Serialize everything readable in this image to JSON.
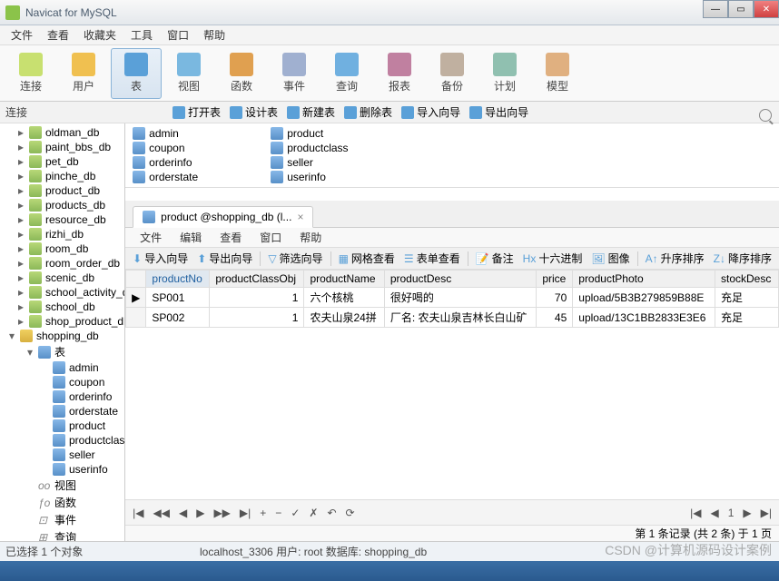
{
  "title": "Navicat for MySQL",
  "menu": [
    "文件",
    "查看",
    "收藏夹",
    "工具",
    "窗口",
    "帮助"
  ],
  "toolbar": [
    {
      "label": "连接",
      "color": "#c8e070"
    },
    {
      "label": "用户",
      "color": "#f0c050"
    },
    {
      "label": "表",
      "color": "#5aa0d8",
      "selected": true
    },
    {
      "label": "视图",
      "color": "#7ab8e0"
    },
    {
      "label": "函数",
      "color": "#e0a050"
    },
    {
      "label": "事件",
      "color": "#a0b0d0"
    },
    {
      "label": "查询",
      "color": "#70b0e0"
    },
    {
      "label": "报表",
      "color": "#c080a0"
    },
    {
      "label": "备份",
      "color": "#c0b0a0"
    },
    {
      "label": "计划",
      "color": "#90c0b0"
    },
    {
      "label": "模型",
      "color": "#e0b080"
    }
  ],
  "ribbon_left": "连接",
  "ribbon": [
    "打开表",
    "设计表",
    "新建表",
    "删除表",
    "导入向导",
    "导出向导"
  ],
  "tree": {
    "databases": [
      "oldman_db",
      "paint_bbs_db",
      "pet_db",
      "pinche_db",
      "product_db",
      "products_db",
      "resource_db",
      "rizhi_db",
      "room_db",
      "room_order_db",
      "scenic_db",
      "school_activity_db",
      "school_db",
      "shop_product_db"
    ],
    "active_db": "shopping_db",
    "active_node": "表",
    "tables": [
      "admin",
      "coupon",
      "orderinfo",
      "orderstate",
      "product",
      "productclass",
      "seller",
      "userinfo"
    ],
    "other_nodes": [
      "视图",
      "函数",
      "事件",
      "查询"
    ]
  },
  "objects": {
    "col1": [
      "admin",
      "coupon",
      "orderinfo",
      "orderstate"
    ],
    "col2": [
      "product",
      "productclass",
      "seller",
      "userinfo"
    ]
  },
  "tab": {
    "label": "product @shopping_db (l...",
    "close": "×"
  },
  "sub_menu": [
    "文件",
    "编辑",
    "查看",
    "窗口",
    "帮助"
  ],
  "sub_tool": [
    "导入向导",
    "导出向导",
    "筛选向导",
    "网格查看",
    "表单查看",
    "备注",
    "十六进制",
    "图像",
    "升序排序",
    "降序排序"
  ],
  "table": {
    "columns": [
      "productNo",
      "productClassObj",
      "productName",
      "productDesc",
      "price",
      "productPhoto",
      "stockDesc"
    ],
    "rows": [
      {
        "productNo": "SP001",
        "productClassObj": "1",
        "productName": "六个核桃",
        "productDesc": "很好喝的",
        "price": "70",
        "productPhoto": "upload/5B3B279859B88E",
        "stockDesc": "充足"
      },
      {
        "productNo": "SP002",
        "productClassObj": "1",
        "productName": "农夫山泉24拼",
        "productDesc": "厂名: 农夫山泉吉林长白山矿",
        "price": "45",
        "productPhoto": "upload/13C1BB2833E3E6",
        "stockDesc": "充足"
      }
    ]
  },
  "nav": {
    "first": "|◀",
    "prev": "◀",
    "prevp": "◀◀",
    "nextp": "▶▶",
    "next": "▶",
    "last": "▶|",
    "plus": "+",
    "minus": "−",
    "check": "✓",
    "x": "✗",
    "undo": "↶",
    "refresh": "⟳",
    "page_info": "第 1 条记录 (共 2 条) 于 1 页"
  },
  "status": {
    "left": "已选择 1 个对象",
    "mid": "localhost_3306   用户: root   数据库: shopping_db"
  },
  "watermark": "CSDN @计算机源码设计案例"
}
